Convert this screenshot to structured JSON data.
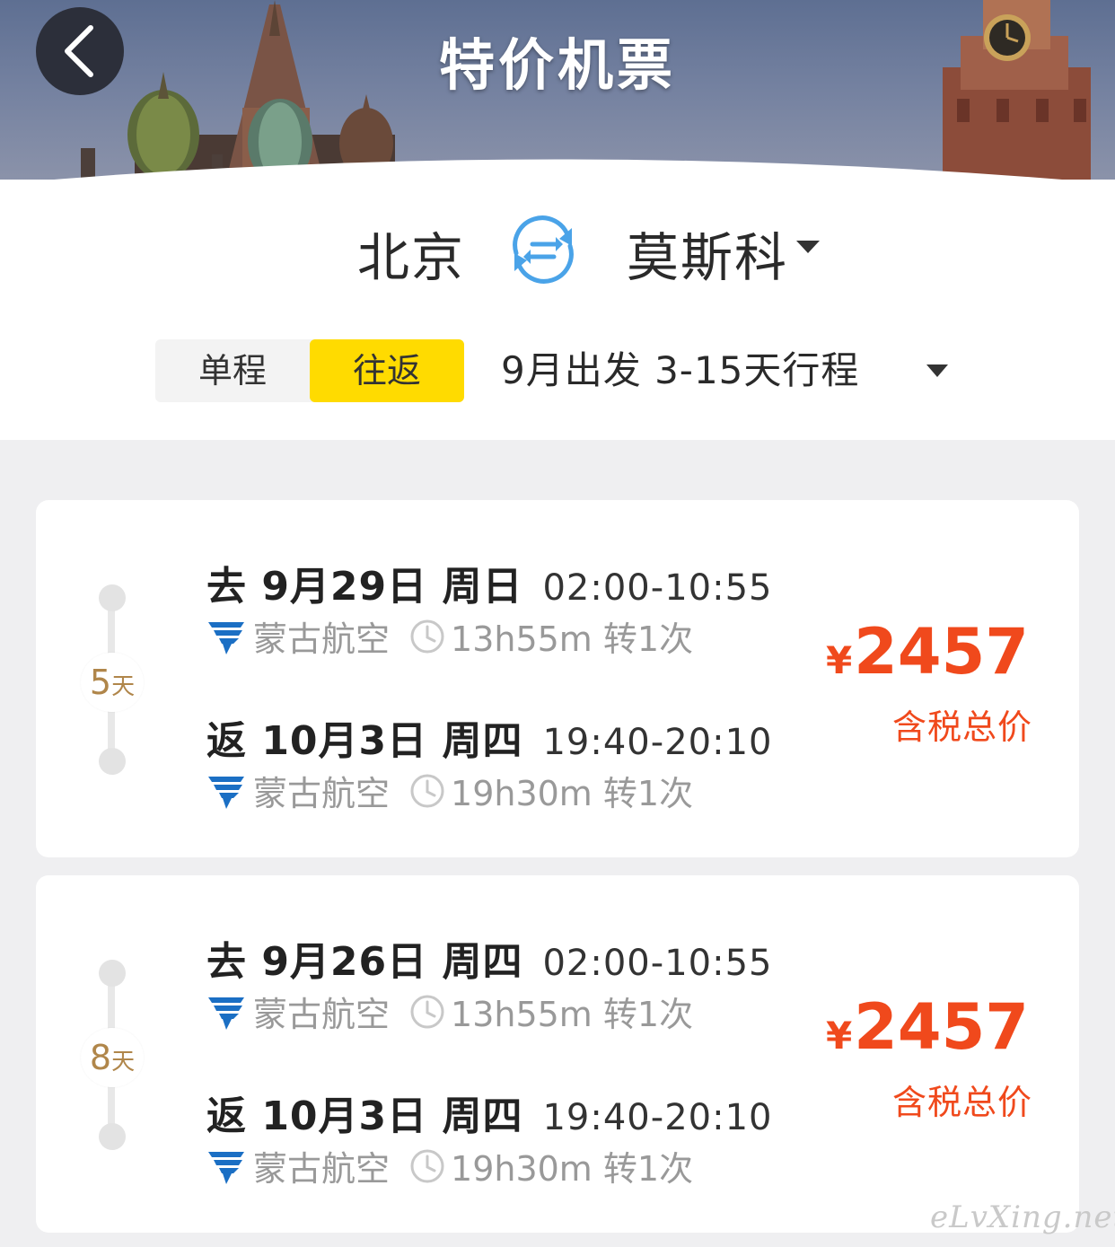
{
  "header": {
    "title": "特价机票",
    "back_icon": "chevron-left-icon"
  },
  "route": {
    "from": "北京",
    "to": "莫斯科",
    "swap_icon": "swap-icon"
  },
  "trip_type": {
    "options": [
      "单程",
      "往返"
    ],
    "selected": "往返"
  },
  "date_filter": {
    "label": "9月出发 3-15天行程"
  },
  "colors": {
    "accent_yellow": "#ffdb00",
    "price_red": "#f0491c",
    "days_brown": "#b0864a"
  },
  "flights": [
    {
      "days_num": "5",
      "days_unit": "天",
      "outbound": {
        "head": "去 9月29日 周日",
        "time": "02:00-10:55",
        "airline": "蒙古航空",
        "duration": "13h55m 转1次"
      },
      "return": {
        "head": "返 10月3日 周四",
        "time": "19:40-20:10",
        "airline": "蒙古航空",
        "duration": "19h30m 转1次"
      },
      "currency": "¥",
      "price": "2457",
      "price_label": "含税总价"
    },
    {
      "days_num": "8",
      "days_unit": "天",
      "outbound": {
        "head": "去 9月26日 周四",
        "time": "02:00-10:55",
        "airline": "蒙古航空",
        "duration": "13h55m 转1次"
      },
      "return": {
        "head": "返 10月3日 周四",
        "time": "19:40-20:10",
        "airline": "蒙古航空",
        "duration": "19h30m 转1次"
      },
      "currency": "¥",
      "price": "2457",
      "price_label": "含税总价"
    }
  ],
  "watermark": "eLvXing.net"
}
